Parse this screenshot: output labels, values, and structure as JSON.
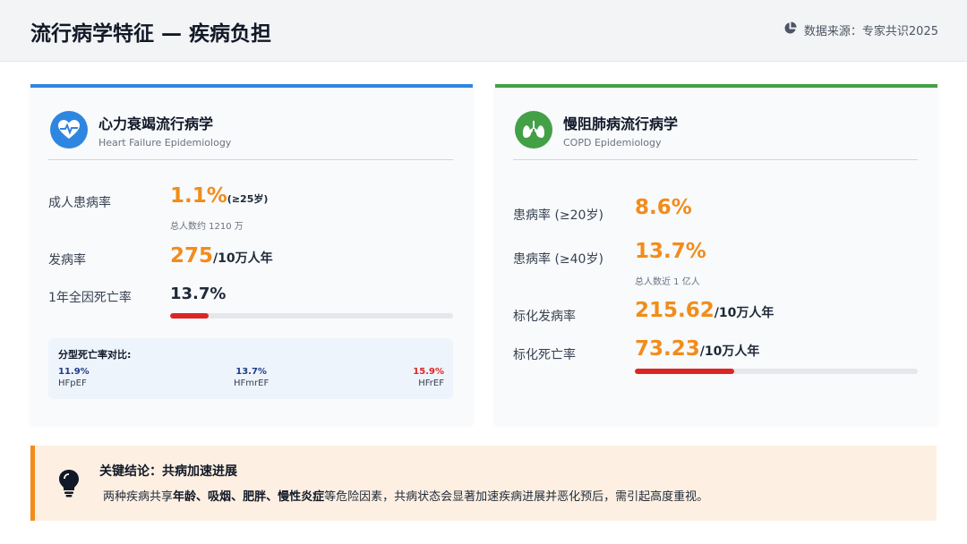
{
  "header": {
    "title": "流行病学特征 — 疾病负担",
    "source": "数据来源：专家共识2025",
    "source_icon": "pie-chart-icon"
  },
  "hf": {
    "accent": "#2f86e0",
    "icon": "heartbeat-icon",
    "title": "心力衰竭流行病学",
    "subtitle": "Heart Failure Epidemiology",
    "prevalence_label": "成人患病率",
    "prevalence_value": "1.1%",
    "prevalence_suffix": "(≥25岁)",
    "prevalence_note": "总人数约 1210 万",
    "incidence_label": "发病率",
    "incidence_value": "275",
    "incidence_unit": "/10万人年",
    "mortality_label": "1年全因死亡率",
    "mortality_value": "13.7%",
    "mortality_fraction": 0.137,
    "subtype_title": "分型死亡率对比:",
    "subtypes": [
      {
        "value": "11.9%",
        "name": "HFpEF",
        "color": "#1e3a8a"
      },
      {
        "value": "13.7%",
        "name": "HFmrEF",
        "color": "#1e3a8a"
      },
      {
        "value": "15.9%",
        "name": "HFrEF",
        "color": "#dc2626"
      }
    ]
  },
  "copd": {
    "accent": "#43a047",
    "icon": "lungs-icon",
    "title": "慢阻肺病流行病学",
    "subtitle": "COPD Epidemiology",
    "prev20_label": "患病率 (≥20岁)",
    "prev20_value": "8.6%",
    "prev40_label": "患病率 (≥40岁)",
    "prev40_value": "13.7%",
    "prev40_note": "总人数近 1 亿人",
    "std_incidence_label": "标化发病率",
    "std_incidence_value": "215.62",
    "std_incidence_unit": "/10万人年",
    "std_mortality_label": "标化死亡率",
    "std_mortality_value": "73.23",
    "std_mortality_unit": "/10万人年",
    "std_mortality_fraction": 0.35
  },
  "conclusion": {
    "icon": "lightbulb-icon",
    "title": "关键结论：共病加速进展",
    "text_pre": "两种疾病共享",
    "highlight1": "年龄",
    "sep1": "、",
    "highlight2": "吸烟",
    "sep2": "、",
    "highlight3": "肥胖",
    "sep3": "、",
    "highlight4": "慢性炎症",
    "text_post": "等危险因素，共病状态会显著加速疾病进展并恶化预后，需引起高度重视。"
  }
}
